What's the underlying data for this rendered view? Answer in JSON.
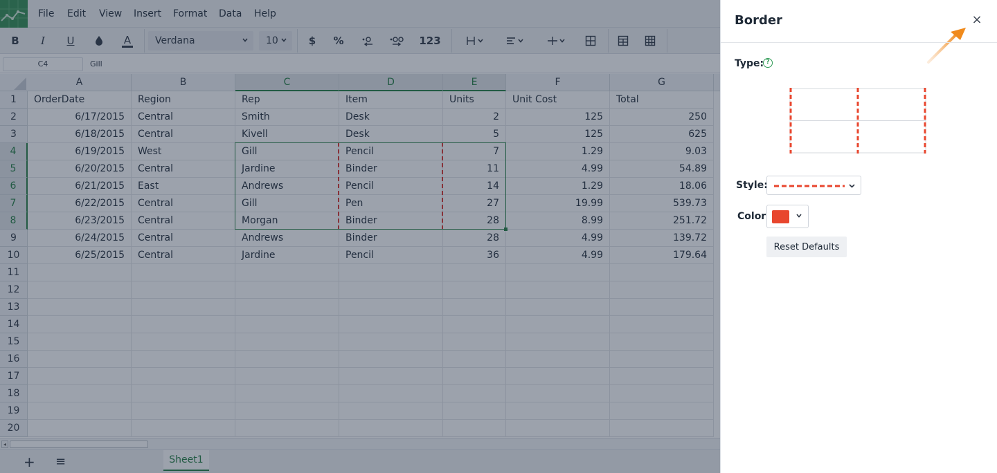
{
  "menu": [
    "File",
    "Edit",
    "View",
    "Insert",
    "Format",
    "Data",
    "Help"
  ],
  "toolbar": {
    "bold": "B",
    "italic": "I",
    "underline": "U",
    "text_color": "A",
    "font": "Verdana",
    "font_size": "10",
    "currency": "$",
    "percent": "%",
    "number_format": "123"
  },
  "formula_bar": {
    "cell_ref": "C4",
    "value": "Gill"
  },
  "columns": [
    "A",
    "B",
    "C",
    "D",
    "E",
    "F",
    "G"
  ],
  "selected_columns": [
    "C",
    "D",
    "E"
  ],
  "rows": [
    [
      "OrderDate",
      "Region",
      "Rep",
      "Item",
      "Units",
      "Unit Cost",
      "Total"
    ],
    [
      "6/17/2015",
      "Central",
      "Smith",
      "Desk",
      "2",
      "125",
      "250"
    ],
    [
      "6/18/2015",
      "Central",
      "Kivell",
      "Desk",
      "5",
      "125",
      "625"
    ],
    [
      "6/19/2015",
      "West",
      "Gill",
      "Pencil",
      "7",
      "1.29",
      "9.03"
    ],
    [
      "6/20/2015",
      "Central",
      "Jardine",
      "Binder",
      "11",
      "4.99",
      "54.89"
    ],
    [
      "6/21/2015",
      "East",
      "Andrews",
      "Pencil",
      "14",
      "1.29",
      "18.06"
    ],
    [
      "6/22/2015",
      "Central",
      "Gill",
      "Pen",
      "27",
      "19.99",
      "539.73"
    ],
    [
      "6/23/2015",
      "Central",
      "Morgan",
      "Binder",
      "28",
      "8.99",
      "251.72"
    ],
    [
      "6/24/2015",
      "Central",
      "Andrews",
      "Binder",
      "28",
      "4.99",
      "139.72"
    ],
    [
      "6/25/2015",
      "Central",
      "Jardine",
      "Pencil",
      "36",
      "4.99",
      "179.64"
    ]
  ],
  "row_numbers": [
    "1",
    "2",
    "3",
    "4",
    "5",
    "6",
    "7",
    "8",
    "9",
    "10",
    "11",
    "12",
    "13",
    "14",
    "15",
    "16",
    "17",
    "18",
    "19",
    "20"
  ],
  "selected_rows": [
    "4",
    "5",
    "6",
    "7",
    "8"
  ],
  "sheets": [
    "Sheet1"
  ],
  "panel": {
    "title": "Border",
    "close_label": "×",
    "type_label": "Type:",
    "style_label": "Style:",
    "color_label": "Color:",
    "reset_label": "Reset Defaults",
    "border_color": "#e8462e"
  },
  "colors": {
    "accent": "#1e7a3e",
    "brand": "#2e8b4e",
    "border_dash": "#d9302c"
  }
}
